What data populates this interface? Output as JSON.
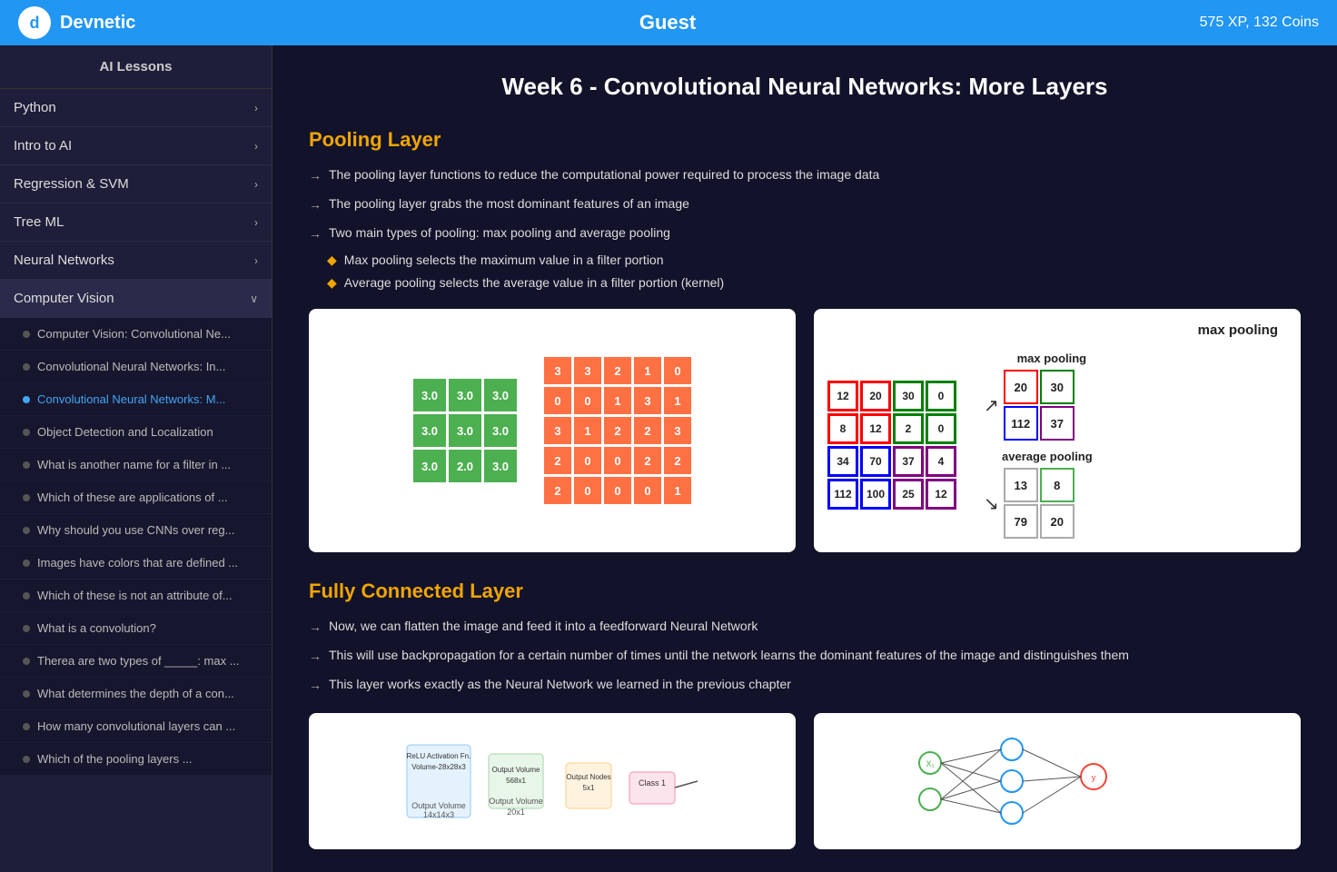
{
  "header": {
    "logo_letter": "d",
    "app_name": "Devnetic",
    "user": "Guest",
    "xp": "575 XP, 132 Coins"
  },
  "sidebar": {
    "header": "AI Lessons",
    "categories": [
      {
        "id": "python",
        "label": "Python",
        "expanded": false
      },
      {
        "id": "intro",
        "label": "Intro to AI",
        "expanded": false
      },
      {
        "id": "regression",
        "label": "Regression & SVM",
        "expanded": false
      },
      {
        "id": "tree",
        "label": "Tree ML",
        "expanded": false
      },
      {
        "id": "neural",
        "label": "Neural Networks",
        "expanded": false
      },
      {
        "id": "cv",
        "label": "Computer Vision",
        "expanded": true
      }
    ],
    "cv_subitems": [
      {
        "id": "cv1",
        "label": "Computer Vision: Convolutional Ne...",
        "active": false
      },
      {
        "id": "cv2",
        "label": "Convolutional Neural Networks: In...",
        "active": false
      },
      {
        "id": "cv3",
        "label": "Convolutional Neural Networks: M...",
        "active": true
      },
      {
        "id": "cv4",
        "label": "Object Detection and Localization",
        "active": false
      },
      {
        "id": "cv5",
        "label": "What is another name for a filter in ...",
        "active": false
      },
      {
        "id": "cv6",
        "label": "Which of these are applications of ...",
        "active": false
      },
      {
        "id": "cv7",
        "label": "Why should you use CNNs over reg...",
        "active": false
      },
      {
        "id": "cv8",
        "label": "Images have colors that are defined ...",
        "active": false
      },
      {
        "id": "cv9",
        "label": "Which of these is not an attribute of...",
        "active": false
      },
      {
        "id": "cv10",
        "label": "What is a convolution?",
        "active": false
      },
      {
        "id": "cv11",
        "label": "Therea are two types of _____: max ...",
        "active": false
      },
      {
        "id": "cv12",
        "label": "What determines the depth of a con...",
        "active": false
      },
      {
        "id": "cv13",
        "label": "How many convolutional layers can ...",
        "active": false
      },
      {
        "id": "cv14",
        "label": "Which of the pooling layers ...",
        "active": false
      }
    ]
  },
  "main": {
    "page_title": "Week 6 - Convolutional Neural Networks: More Layers",
    "pooling_section": {
      "title": "Pooling Layer",
      "bullets": [
        "The pooling layer functions to reduce the computational power required to process the image data",
        "The pooling layer grabs the most dominant features of an image",
        "Two main types of pooling: max pooling and average pooling"
      ],
      "sub_bullets": [
        "Max pooling selects the maximum value in a filter portion",
        "Average pooling selects the average value in a filter portion (kernel)"
      ]
    },
    "fully_connected_section": {
      "title": "Fully Connected Layer",
      "bullets": [
        "Now, we can flatten the image and feed it into a feedforward Neural Network",
        "This will use backpropagation for a certain number of times until the network learns the dominant features of the image and distinguishes them",
        "This layer works exactly as the Neural Network we learned in the previous chapter"
      ]
    },
    "small_grid": [
      [
        "3.0",
        "3.0",
        "3.0"
      ],
      [
        "3.0",
        "3.0",
        "3.0"
      ],
      [
        "3.0",
        "2.0",
        "3.0"
      ]
    ],
    "large_grid": [
      [
        "3",
        "3",
        "2",
        "1",
        "0"
      ],
      [
        "0",
        "0",
        "1",
        "3",
        "1"
      ],
      [
        "3",
        "1",
        "2",
        "2",
        "3"
      ],
      [
        "2",
        "0",
        "0",
        "2",
        "2"
      ],
      [
        "2",
        "0",
        "0",
        "0",
        "1"
      ]
    ],
    "pool_matrix": [
      [
        "12",
        "20",
        "30",
        "0"
      ],
      [
        "8",
        "12",
        "2",
        "0"
      ],
      [
        "34",
        "70",
        "37",
        "4"
      ],
      [
        "112",
        "100",
        "25",
        "12"
      ]
    ],
    "max_pool_result": [
      [
        "20",
        "30"
      ],
      [
        "112",
        "37"
      ]
    ],
    "avg_pool_result": [
      [
        "13",
        "8"
      ],
      [
        "79",
        "20"
      ]
    ],
    "max_pooling_label": "max pooling",
    "avg_pooling_label": "average pooling"
  }
}
